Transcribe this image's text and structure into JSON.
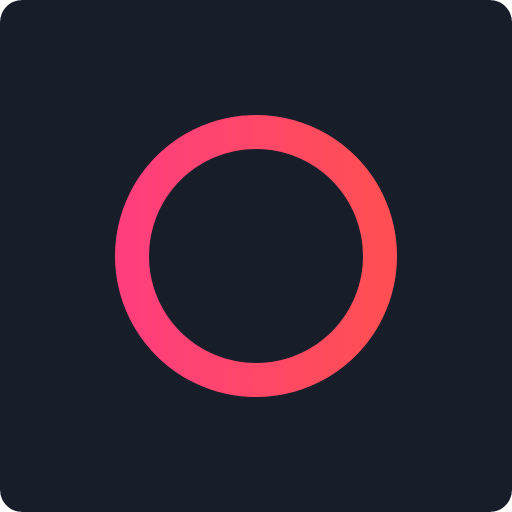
{
  "icon": {
    "name": "ring-icon",
    "background_color": "#181d2a",
    "ring_gradient_start": "#ff3f7c",
    "ring_gradient_end": "#ff4f54"
  }
}
